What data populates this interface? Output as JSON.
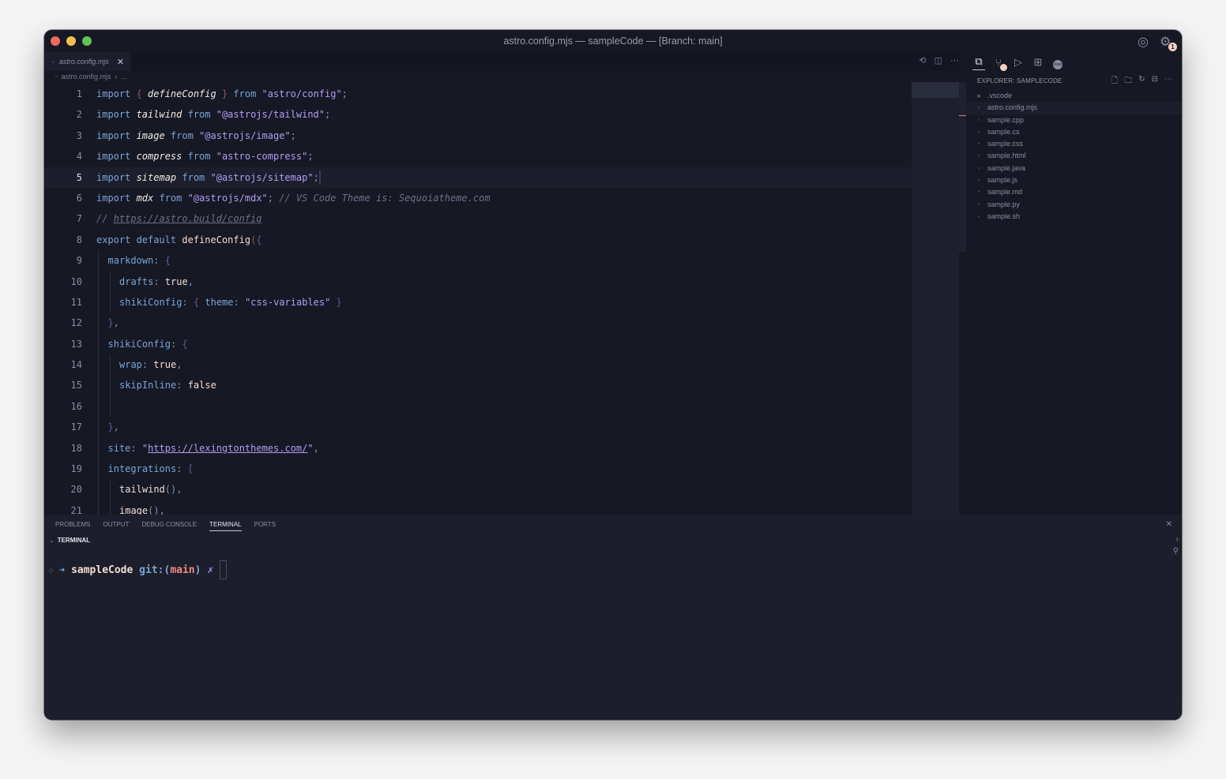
{
  "window": {
    "title": "astro.config.mjs — sampleCode — [Branch: main]",
    "traffic_lights": {
      "close": "#ed6a5e",
      "minimize": "#f5bf4f",
      "maximize": "#61c554"
    },
    "titlebar_icons": [
      {
        "name": "account-icon",
        "glyph": "◎"
      },
      {
        "name": "settings-gear-icon",
        "glyph": "⚙",
        "badge": "1"
      }
    ]
  },
  "editor": {
    "tab": {
      "label": "astro.config.mjs",
      "close_glyph": "✕",
      "file_icon": "▫"
    },
    "actions": [
      {
        "name": "timeline-icon",
        "glyph": "⟲"
      },
      {
        "name": "split-editor-icon",
        "glyph": "◫"
      },
      {
        "name": "more-actions-icon",
        "glyph": "⋯"
      }
    ],
    "breadcrumb": [
      "astro.config.mjs",
      "›",
      "..."
    ],
    "active_line": 5,
    "lines": [
      {
        "n": "1",
        "indent": 0,
        "tokens": [
          [
            "kw",
            "import "
          ],
          [
            "brr",
            "{ "
          ],
          [
            "id",
            "defineConfig"
          ],
          [
            "brr",
            " }"
          ],
          [
            "kw",
            " from "
          ],
          [
            "str",
            "\"astro/config\""
          ],
          [
            "pu",
            ";"
          ]
        ]
      },
      {
        "n": "2",
        "indent": 0,
        "tokens": [
          [
            "kw",
            "import "
          ],
          [
            "id",
            "tailwind"
          ],
          [
            "kw",
            " from "
          ],
          [
            "str",
            "\"@astrojs/tailwind\""
          ],
          [
            "pu",
            ";"
          ]
        ]
      },
      {
        "n": "3",
        "indent": 0,
        "tokens": [
          [
            "kw",
            "import "
          ],
          [
            "id",
            "image"
          ],
          [
            "kw",
            " from "
          ],
          [
            "str",
            "\"@astrojs/image\""
          ],
          [
            "pu",
            ";"
          ]
        ]
      },
      {
        "n": "4",
        "indent": 0,
        "tokens": [
          [
            "kw",
            "import "
          ],
          [
            "id",
            "compress"
          ],
          [
            "kw",
            " from "
          ],
          [
            "str",
            "\"astro-compress\""
          ],
          [
            "pu",
            ";"
          ]
        ]
      },
      {
        "n": "5",
        "indent": 0,
        "tokens": [
          [
            "kw",
            "import "
          ],
          [
            "id",
            "sitemap"
          ],
          [
            "kw",
            " from "
          ],
          [
            "str",
            "\"@astrojs/sitemap\""
          ],
          [
            "pu",
            ";"
          ]
        ]
      },
      {
        "n": "6",
        "indent": 0,
        "tokens": [
          [
            "kw",
            "import "
          ],
          [
            "id",
            "mdx"
          ],
          [
            "kw",
            " from "
          ],
          [
            "str",
            "\"@astrojs/mdx\""
          ],
          [
            "pu",
            "; "
          ],
          [
            "cm",
            "// VS Code Theme is: Sequoiatheme.com"
          ]
        ]
      },
      {
        "n": "7",
        "indent": 0,
        "tokens": [
          [
            "cm",
            "// "
          ],
          [
            "cm url",
            "https://astro.build/config"
          ]
        ]
      },
      {
        "n": "8",
        "indent": 0,
        "tokens": [
          [
            "kw",
            "export default "
          ],
          [
            "fn",
            "defineConfig"
          ],
          [
            "brr",
            "("
          ],
          [
            "br",
            "{"
          ]
        ]
      },
      {
        "n": "9",
        "indent": 1,
        "tokens": [
          [
            "pr",
            "markdown"
          ],
          [
            "pu",
            ": "
          ],
          [
            "br",
            "{"
          ]
        ]
      },
      {
        "n": "10",
        "indent": 2,
        "tokens": [
          [
            "pr",
            "drafts"
          ],
          [
            "pu",
            ": "
          ],
          [
            "val",
            "true"
          ],
          [
            "pu",
            ","
          ]
        ]
      },
      {
        "n": "11",
        "indent": 2,
        "tokens": [
          [
            "pr",
            "shikiConfig"
          ],
          [
            "pu",
            ": "
          ],
          [
            "br",
            "{ "
          ],
          [
            "pr",
            "theme"
          ],
          [
            "pu",
            ": "
          ],
          [
            "str",
            "\"css-variables\""
          ],
          [
            "br",
            " }"
          ]
        ]
      },
      {
        "n": "12",
        "indent": 1,
        "tokens": [
          [
            "br",
            "}"
          ],
          [
            "pu",
            ","
          ]
        ]
      },
      {
        "n": "13",
        "indent": 1,
        "tokens": [
          [
            "pr",
            "shikiConfig"
          ],
          [
            "pu",
            ": "
          ],
          [
            "br",
            "{"
          ]
        ]
      },
      {
        "n": "14",
        "indent": 2,
        "tokens": [
          [
            "pr",
            "wrap"
          ],
          [
            "pu",
            ": "
          ],
          [
            "val",
            "true"
          ],
          [
            "pu",
            ","
          ]
        ]
      },
      {
        "n": "15",
        "indent": 2,
        "tokens": [
          [
            "pr",
            "skipInline"
          ],
          [
            "pu",
            ": "
          ],
          [
            "val",
            "false"
          ]
        ]
      },
      {
        "n": "16",
        "indent": 2,
        "tokens": []
      },
      {
        "n": "17",
        "indent": 1,
        "tokens": [
          [
            "br",
            "}"
          ],
          [
            "pu",
            ","
          ]
        ]
      },
      {
        "n": "18",
        "indent": 1,
        "tokens": [
          [
            "pr",
            "site"
          ],
          [
            "pu",
            ": "
          ],
          [
            "str",
            "\""
          ],
          [
            "str url",
            "https://lexingtonthemes.com/"
          ],
          [
            "str",
            "\""
          ],
          [
            "pu",
            ","
          ]
        ]
      },
      {
        "n": "19",
        "indent": 1,
        "tokens": [
          [
            "pr",
            "integrations"
          ],
          [
            "pu",
            ": "
          ],
          [
            "br",
            "["
          ]
        ]
      },
      {
        "n": "20",
        "indent": 2,
        "tokens": [
          [
            "fn",
            "tailwind"
          ],
          [
            "pu",
            "(),"
          ]
        ]
      },
      {
        "n": "21",
        "indent": 2,
        "tokens": [
          [
            "fn",
            "image"
          ],
          [
            "pu",
            "(),"
          ]
        ]
      }
    ]
  },
  "sidebar": {
    "activity": [
      {
        "name": "explorer-icon",
        "glyph": "⧉",
        "active": true
      },
      {
        "name": "source-control-icon",
        "glyph": "⑂",
        "dot": true
      },
      {
        "name": "run-debug-icon",
        "glyph": "▷"
      },
      {
        "name": "extensions-icon",
        "glyph": "⊞"
      },
      {
        "name": "json-icon",
        "glyph": "Json"
      }
    ],
    "header": "EXPLORER: SAMPLECODE",
    "header_actions": [
      {
        "name": "new-file-icon",
        "glyph": "🗋"
      },
      {
        "name": "new-folder-icon",
        "glyph": "🗀"
      },
      {
        "name": "refresh-icon",
        "glyph": "↻"
      },
      {
        "name": "collapse-all-icon",
        "glyph": "⊟"
      },
      {
        "name": "more-icon",
        "glyph": "⋯"
      }
    ],
    "files": [
      {
        "label": ".vscode",
        "folder": true
      },
      {
        "label": "astro.config.mjs",
        "selected": true
      },
      {
        "label": "sample.cpp"
      },
      {
        "label": "sample.cs"
      },
      {
        "label": "sample.css"
      },
      {
        "label": "sample.html"
      },
      {
        "label": "sample.java"
      },
      {
        "label": "sample.js"
      },
      {
        "label": "sample.md"
      },
      {
        "label": "sample.py"
      },
      {
        "label": "sample.sh"
      }
    ]
  },
  "panel": {
    "tabs": [
      "PROBLEMS",
      "OUTPUT",
      "DEBUG CONSOLE",
      "TERMINAL",
      "PORTS"
    ],
    "active_tab": "TERMINAL",
    "section": "TERMINAL",
    "prompt": {
      "arrow": "➜",
      "dir": "sampleCode",
      "git_prefix": "git:(",
      "branch": "main",
      "git_suffix": ")",
      "dirty": "✗"
    }
  }
}
